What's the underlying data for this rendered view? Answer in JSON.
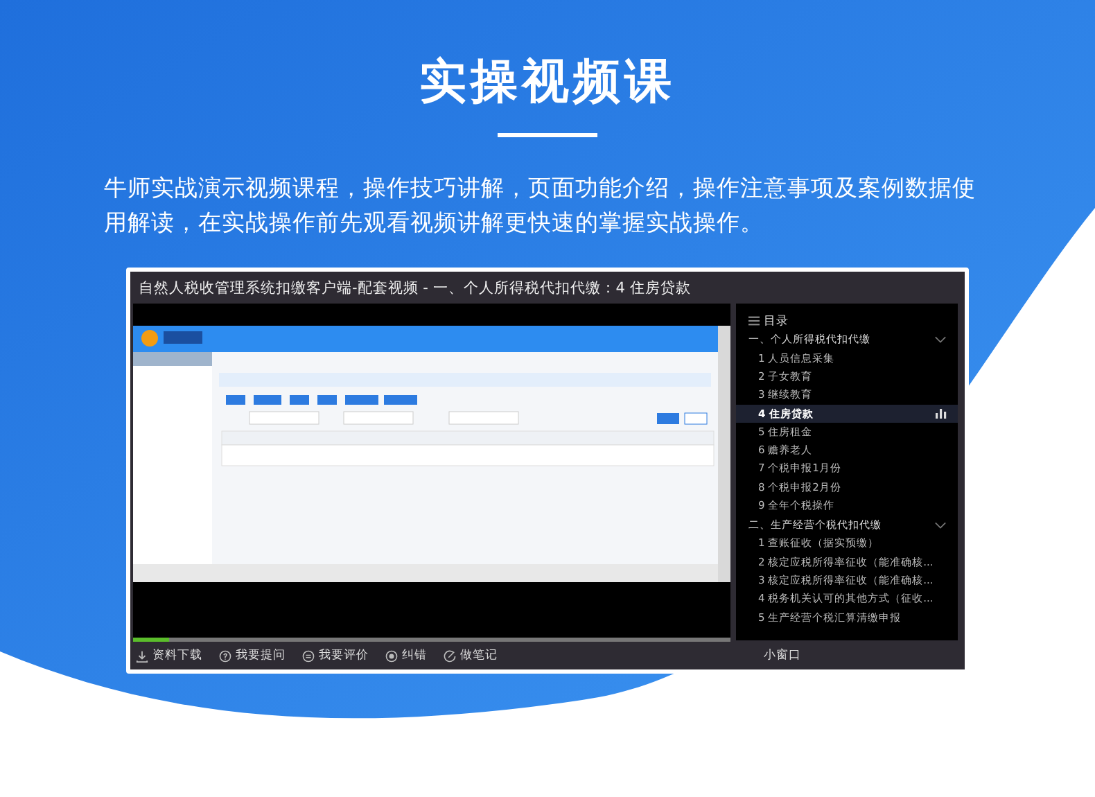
{
  "heading": "实操视频课",
  "intro": "牛师实战演示视频课程，操作技巧讲解，页面功能介绍，操作注意事项及案例数据使用解读，在实战操作前先观看视频讲解更快速的掌握实战操作。",
  "player": {
    "title": "自然人税收管理系统扣缴客户端-配套视频 - 一、个人所得税代扣代缴：4 住房贷款",
    "progress": {
      "level": 0.06
    },
    "catalog": {
      "title": "目录",
      "sections": [
        {
          "title": "一、个人所得税代扣代缴",
          "expanded": true,
          "items": [
            {
              "label": "1 人员信息采集",
              "selected": false
            },
            {
              "label": "2 子女教育",
              "selected": false
            },
            {
              "label": "3 继续教育",
              "selected": false
            },
            {
              "label": "4 住房贷款",
              "selected": true
            },
            {
              "label": "5 住房租金",
              "selected": false
            },
            {
              "label": "6 赡养老人",
              "selected": false
            },
            {
              "label": "7 个税申报1月份",
              "selected": false
            },
            {
              "label": "8 个税申报2月份",
              "selected": false
            },
            {
              "label": "9 全年个税操作",
              "selected": false
            }
          ]
        },
        {
          "title": "二、生产经营个税代扣代缴",
          "expanded": true,
          "items": [
            {
              "label": "1 查账征收（据实预缴）",
              "selected": false
            },
            {
              "label": "2 核定应税所得率征收（能准确核...",
              "selected": false
            },
            {
              "label": "3 核定应税所得率征收（能准确核...",
              "selected": false
            },
            {
              "label": "4 税务机关认可的其他方式（征收...",
              "selected": false
            },
            {
              "label": "5 生产经营个税汇算清缴申报",
              "selected": false
            }
          ]
        }
      ]
    },
    "toolbar": [
      {
        "kind": "download",
        "label": "资料下载"
      },
      {
        "kind": "question",
        "label": "我要提问"
      },
      {
        "kind": "comment",
        "label": "我要评价"
      },
      {
        "kind": "error",
        "label": "纠错"
      },
      {
        "kind": "note",
        "label": "做笔记"
      }
    ],
    "mini_window": "小窗口"
  }
}
